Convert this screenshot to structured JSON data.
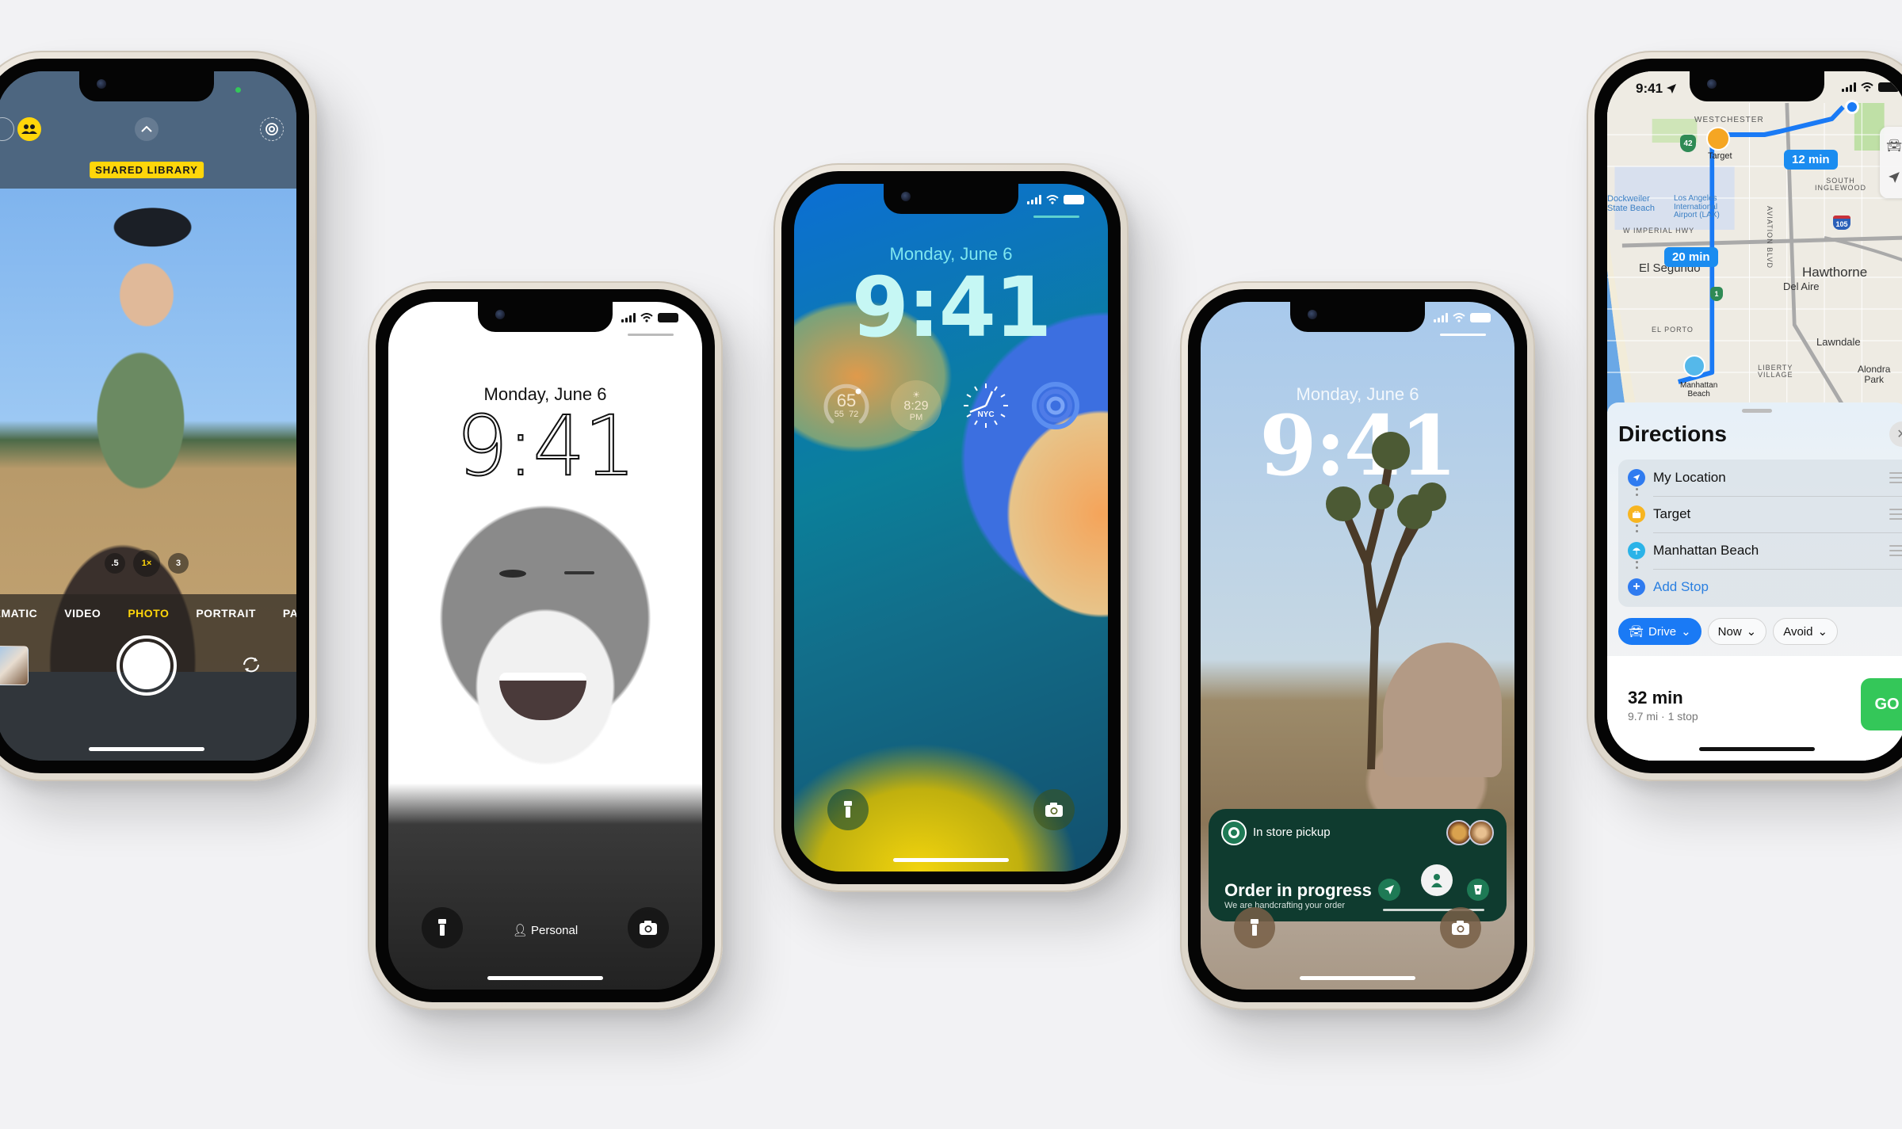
{
  "page": {
    "background": "#f2f2f4"
  },
  "phones": {
    "camera": {
      "shared_library_badge": "SHARED LIBRARY",
      "zoom_levels": [
        ".5",
        "1×",
        "3"
      ],
      "active_zoom": "1×",
      "modes": [
        "CINEMATIC",
        "VIDEO",
        "PHOTO",
        "PORTRAIT",
        "PANO"
      ],
      "active_mode": "PHOTO",
      "accent": "#ffd60a"
    },
    "personal": {
      "date": "Monday, June 6",
      "time": "9:41",
      "focus_label": "Personal"
    },
    "wallpaper": {
      "date": "Monday, June 6",
      "time": "9:41",
      "widgets": {
        "weather_current": "65",
        "weather_low": "55",
        "weather_high": "72",
        "sunset_time": "8:29",
        "sunset_period": "PM",
        "clock_city": "NYC"
      }
    },
    "starbucks": {
      "date": "Monday, June 6",
      "time": "9:41",
      "live_activity": {
        "title": "In store pickup",
        "heading": "Order in progress",
        "subtitle": "We are handcrafting your order",
        "progress_step": 2,
        "total_steps": 3,
        "brand_color": "#0f3b2f"
      }
    },
    "maps": {
      "status_time": "9:41",
      "map_labels": {
        "westchester": "WESTCHESTER",
        "target": "Target",
        "dockweiler": "Dockweiler\nState Beach",
        "lax": "Los Angeles\nInternational\nAirport (LAX)",
        "imperial": "W IMPERIAL HWY",
        "aviation": "AVIATION BLVD",
        "south_inglewood": "SOUTH\nINGLEWOOD",
        "el_segundo": "El Segundo",
        "hawthorne": "Hawthorne",
        "del_aire": "Del Aire",
        "el_porto": "EL PORTO",
        "lawndale": "Lawndale",
        "liberty_village": "LIBERTY\nVILLAGE",
        "alondra_park": "Alondra\nPark",
        "manhattan_beach": "Manhattan\nBeach",
        "route_42": "42",
        "route_105": "105",
        "route_1": "1"
      },
      "leg_times": [
        "12 min",
        "20 min"
      ],
      "directions": {
        "title": "Directions",
        "stops": [
          {
            "label": "My Location",
            "color": "#2f7bf0"
          },
          {
            "label": "Target",
            "color": "#f7b521"
          },
          {
            "label": "Manhattan Beach",
            "color": "#2bb3e8"
          }
        ],
        "add_stop": "Add Stop",
        "transport": "Drive",
        "time_option": "Now",
        "avoid_option": "Avoid",
        "route_time": "32 min",
        "route_meta": "9.7 mi · 1 stop",
        "go_label": "GO",
        "go_color": "#34c759"
      }
    }
  }
}
